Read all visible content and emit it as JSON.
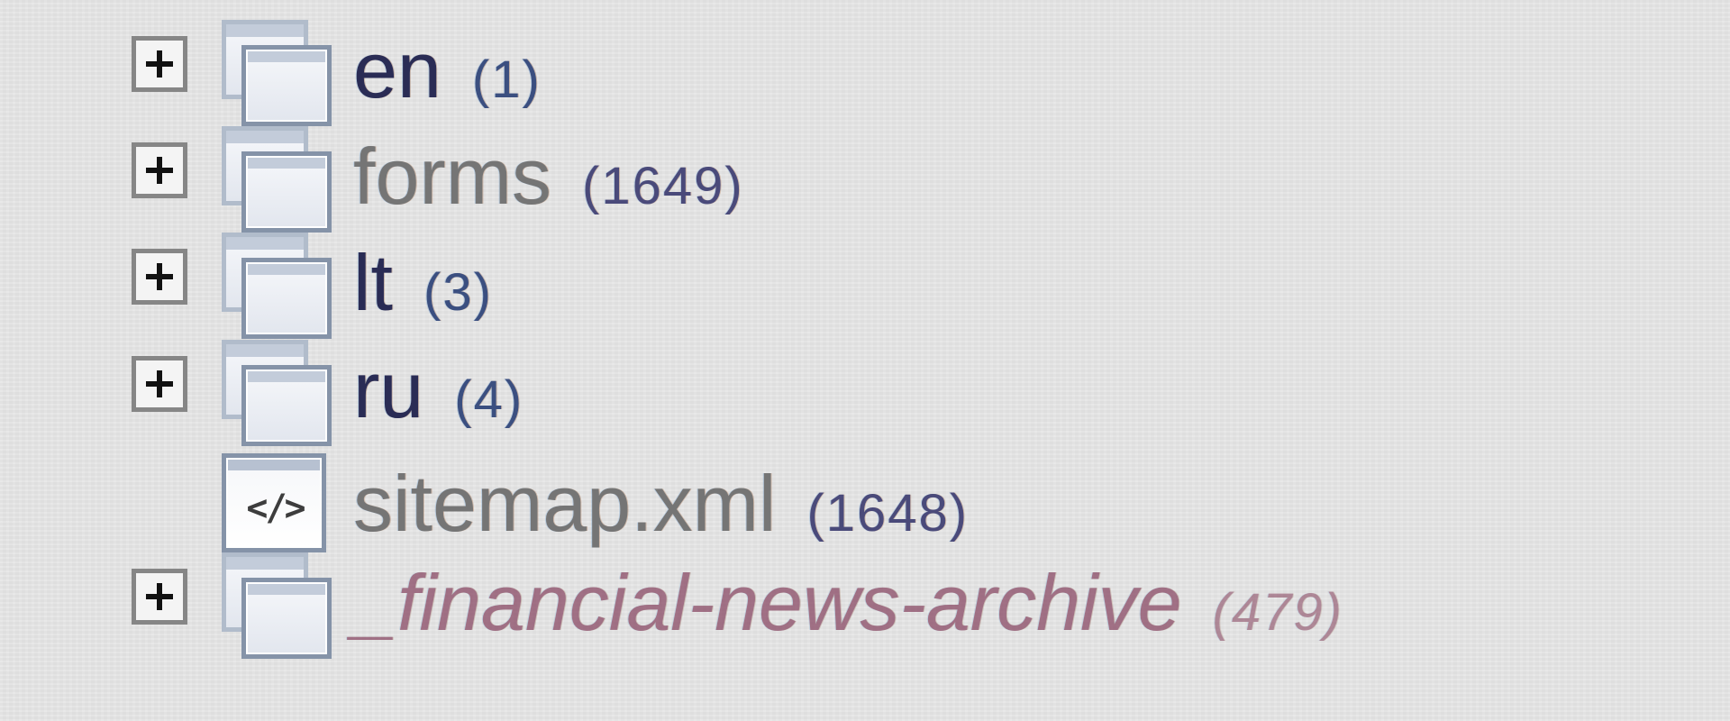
{
  "tree": {
    "nodes": [
      {
        "kind": "folder",
        "expandable": true,
        "name": "en",
        "count": "(1)"
      },
      {
        "kind": "folder",
        "expandable": true,
        "name": "forms",
        "count": "(1649)"
      },
      {
        "kind": "folder",
        "expandable": true,
        "name": "lt",
        "count": "(3)"
      },
      {
        "kind": "folder",
        "expandable": true,
        "name": "ru",
        "count": "(4)"
      },
      {
        "kind": "xml-file",
        "expandable": false,
        "name": "sitemap.xml",
        "count": "(1648)"
      },
      {
        "kind": "folder",
        "expandable": true,
        "name": "_financial-news-archive",
        "count": "(479)"
      }
    ]
  },
  "icons": {
    "expand": "plus-box-icon",
    "folder": "folder-stack-icon",
    "file": "xml-file-icon",
    "xml_glyph": "</>"
  },
  "colors": {
    "background": "#e4e4e4",
    "label": "#2a2c55",
    "label_dim": "#757575",
    "count": "#3b4f80",
    "folder_border": "#8593a8"
  }
}
